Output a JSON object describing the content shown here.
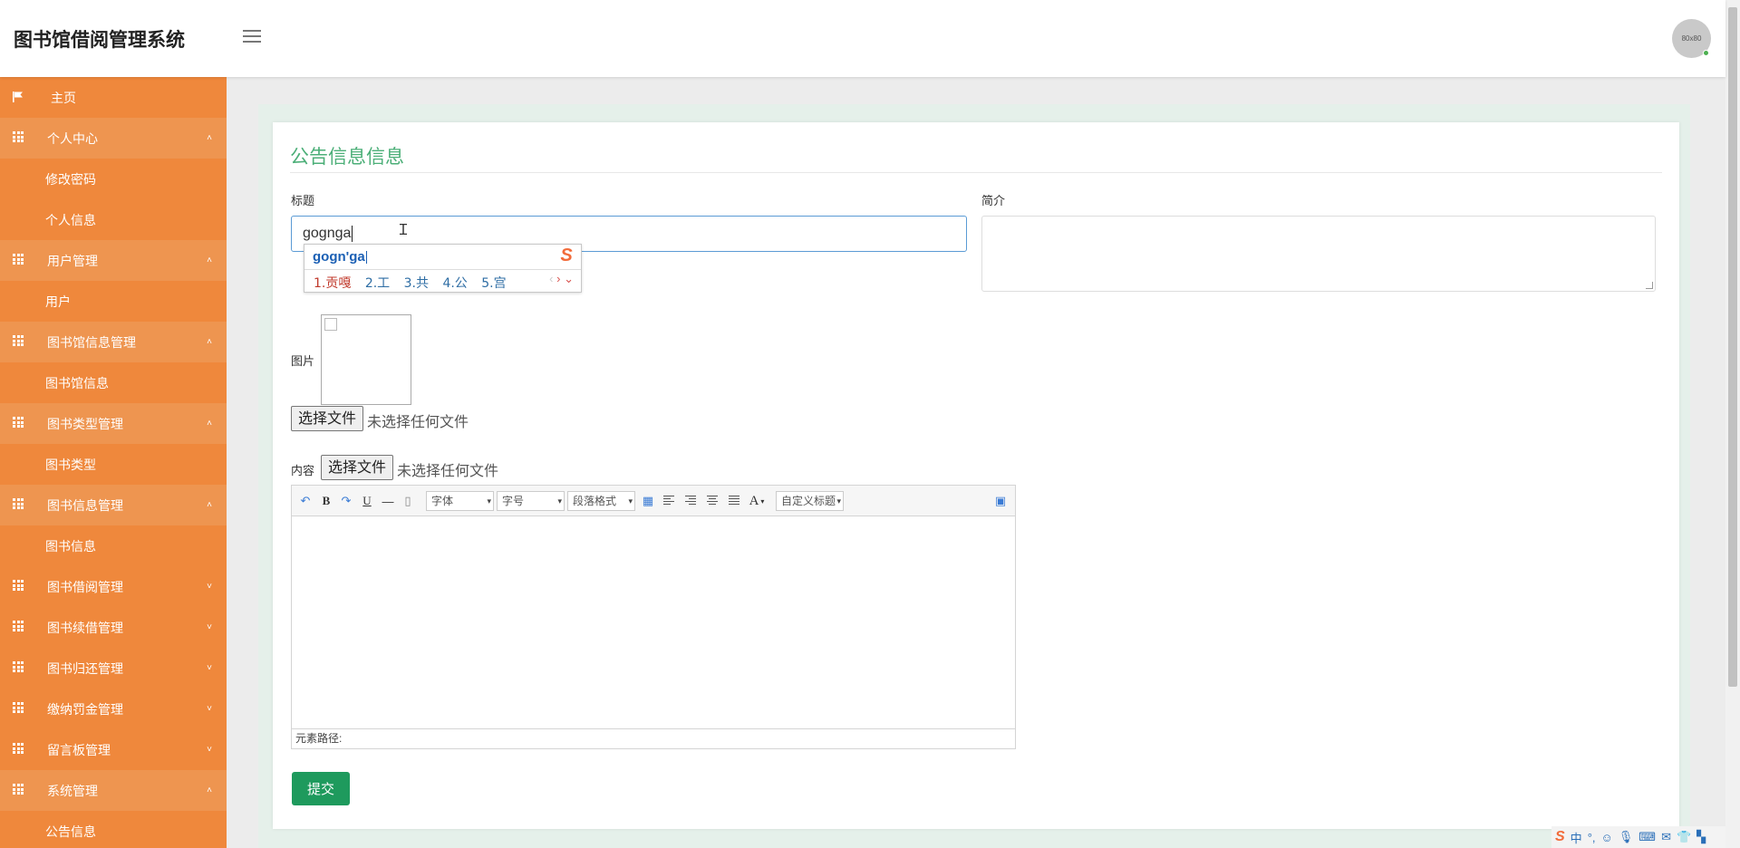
{
  "app": {
    "title": "图书馆借阅管理系统"
  },
  "header": {
    "avatar_text": "80x80"
  },
  "sidebar": {
    "items": [
      {
        "label": "主页",
        "type": "home"
      },
      {
        "label": "个人中心",
        "type": "parent",
        "open": true
      },
      {
        "label": "修改密码",
        "type": "sub"
      },
      {
        "label": "个人信息",
        "type": "sub"
      },
      {
        "label": "用户管理",
        "type": "parent",
        "open": true
      },
      {
        "label": "用户",
        "type": "sub"
      },
      {
        "label": "图书馆信息管理",
        "type": "parent",
        "open": true
      },
      {
        "label": "图书馆信息",
        "type": "sub"
      },
      {
        "label": "图书类型管理",
        "type": "parent",
        "open": true
      },
      {
        "label": "图书类型",
        "type": "sub"
      },
      {
        "label": "图书信息管理",
        "type": "parent",
        "open": true
      },
      {
        "label": "图书信息",
        "type": "sub"
      },
      {
        "label": "图书借阅管理",
        "type": "parent",
        "open": false
      },
      {
        "label": "图书续借管理",
        "type": "parent",
        "open": false
      },
      {
        "label": "图书归还管理",
        "type": "parent",
        "open": false
      },
      {
        "label": "缴纳罚金管理",
        "type": "parent",
        "open": false
      },
      {
        "label": "留言板管理",
        "type": "parent",
        "open": false
      },
      {
        "label": "系统管理",
        "type": "parent",
        "open": true
      },
      {
        "label": "公告信息",
        "type": "sub"
      }
    ]
  },
  "form": {
    "heading": "公告信息信息",
    "title_label": "标题",
    "title_value": "gognga",
    "intro_label": "简介",
    "image_label": "图片",
    "file_button": "选择文件",
    "file_status": "未选择任何文件",
    "content_label": "内容",
    "content_file_button": "选择文件",
    "content_file_status": "未选择任何文件",
    "submit_label": "提交"
  },
  "ime": {
    "pinyin": "gogn'ga",
    "candidates": [
      "1.贡嘎",
      "2.工",
      "3.共",
      "4.公",
      "5.宫"
    ],
    "logo": "S"
  },
  "editor": {
    "font_select": "字体",
    "size_select": "字号",
    "para_select": "段落格式",
    "custom_select": "自定义标题",
    "bold": "B",
    "underline": "U",
    "font_color": "A",
    "footer": "元素路径:"
  },
  "tray": {
    "ime_lang": "中",
    "ime_punct": "°,"
  }
}
